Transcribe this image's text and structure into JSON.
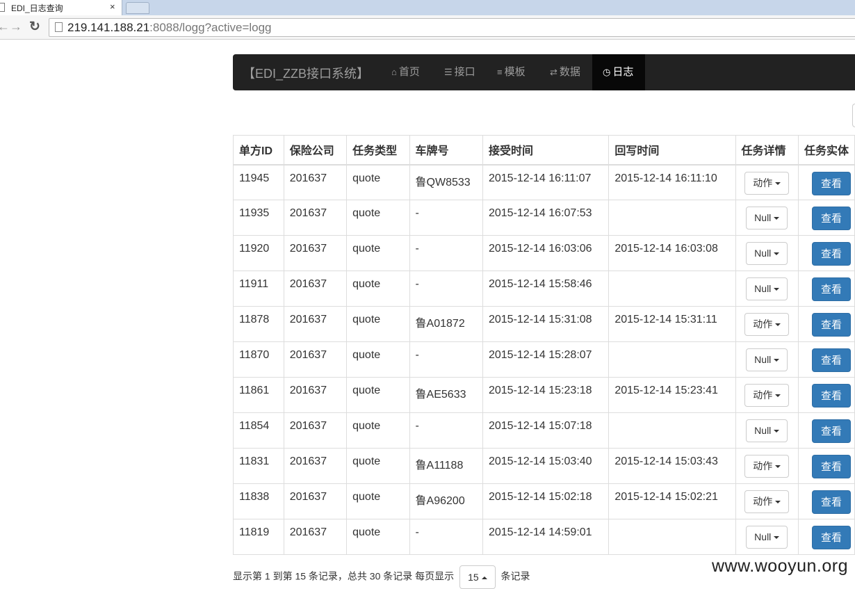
{
  "browser": {
    "tab_title": "EDI_日志查询",
    "tab_close": "×",
    "url_host": "219.141.188.21",
    "url_rest": ":8088/logg?active=logg"
  },
  "navbar": {
    "brand": "【EDI_ZZB接口系统】",
    "items": [
      {
        "label": "首页",
        "icon": "home-icon",
        "glyph": "⌂"
      },
      {
        "label": "接口",
        "icon": "list-icon",
        "glyph": "☰"
      },
      {
        "label": "模板",
        "icon": "align-left-icon",
        "glyph": "≡"
      },
      {
        "label": "数据",
        "icon": "transfer-icon",
        "glyph": "⇄"
      },
      {
        "label": "日志",
        "icon": "clock-icon",
        "glyph": "◷",
        "active": true
      }
    ]
  },
  "table": {
    "headers": [
      "单方ID",
      "保险公司",
      "任务类型",
      "车牌号",
      "接受时间",
      "回写时间",
      "任务详情",
      "任务实体"
    ],
    "rows": [
      {
        "id": "11945",
        "company": "201637",
        "type": "quote",
        "plate": "鲁QW8533",
        "received": "2015-12-14 16:11:07",
        "written": "2015-12-14 16:11:10",
        "detail": "动作",
        "action": "查看"
      },
      {
        "id": "11935",
        "company": "201637",
        "type": "quote",
        "plate": "-",
        "received": "2015-12-14 16:07:53",
        "written": "",
        "detail": "Null",
        "action": "查看"
      },
      {
        "id": "11920",
        "company": "201637",
        "type": "quote",
        "plate": "-",
        "received": "2015-12-14 16:03:06",
        "written": "2015-12-14 16:03:08",
        "detail": "Null",
        "action": "查看"
      },
      {
        "id": "11911",
        "company": "201637",
        "type": "quote",
        "plate": "-",
        "received": "2015-12-14 15:58:46",
        "written": "",
        "detail": "Null",
        "action": "查看"
      },
      {
        "id": "11878",
        "company": "201637",
        "type": "quote",
        "plate": "鲁A01872",
        "received": "2015-12-14 15:31:08",
        "written": "2015-12-14 15:31:11",
        "detail": "动作",
        "action": "查看"
      },
      {
        "id": "11870",
        "company": "201637",
        "type": "quote",
        "plate": "-",
        "received": "2015-12-14 15:28:07",
        "written": "",
        "detail": "Null",
        "action": "查看"
      },
      {
        "id": "11861",
        "company": "201637",
        "type": "quote",
        "plate": "鲁AE5633",
        "received": "2015-12-14 15:23:18",
        "written": "2015-12-14 15:23:41",
        "detail": "动作",
        "action": "查看"
      },
      {
        "id": "11854",
        "company": "201637",
        "type": "quote",
        "plate": "-",
        "received": "2015-12-14 15:07:18",
        "written": "",
        "detail": "Null",
        "action": "查看"
      },
      {
        "id": "11831",
        "company": "201637",
        "type": "quote",
        "plate": "鲁A11188",
        "received": "2015-12-14 15:03:40",
        "written": "2015-12-14 15:03:43",
        "detail": "动作",
        "action": "查看"
      },
      {
        "id": "11838",
        "company": "201637",
        "type": "quote",
        "plate": "鲁A96200",
        "received": "2015-12-14 15:02:18",
        "written": "2015-12-14 15:02:21",
        "detail": "动作",
        "action": "查看"
      },
      {
        "id": "11819",
        "company": "201637",
        "type": "quote",
        "plate": "-",
        "received": "2015-12-14 14:59:01",
        "written": "",
        "detail": "Null",
        "action": "查看"
      }
    ]
  },
  "pagination": {
    "info": "显示第 1 到第 15 条记录，总共 30 条记录 每页显示",
    "page_size": "15",
    "suffix": "条记录"
  },
  "watermark": "www.wooyun.org"
}
